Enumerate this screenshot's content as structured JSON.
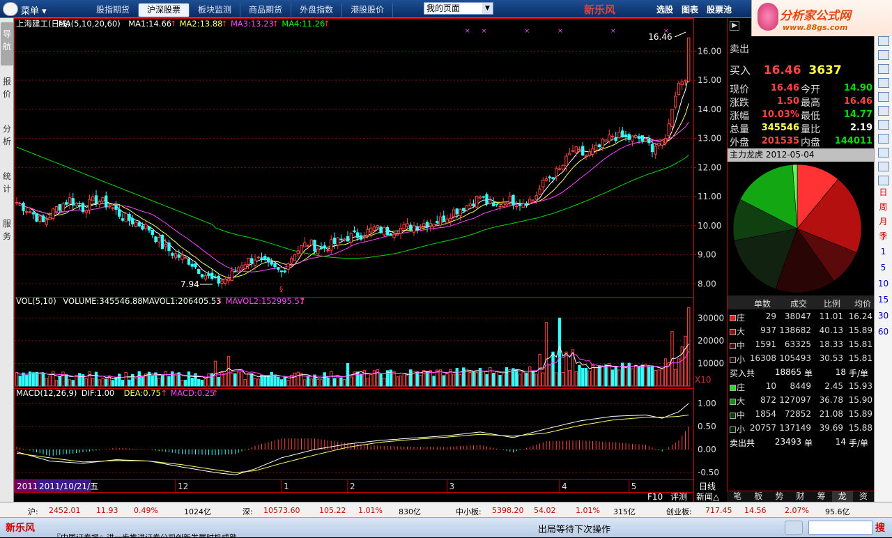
{
  "app": {
    "menu_label": "菜单",
    "brand": "新乐风",
    "status_brand": "新乐风"
  },
  "top_tabs": [
    "股指期货",
    "沪深股票",
    "板块监测",
    "商品期货",
    "外盘指数",
    "港股股价"
  ],
  "active_tab": 1,
  "page_select": "我的页面",
  "right_menu": [
    "选股",
    "图表",
    "股票池"
  ],
  "ad": {
    "line1": "分析家公式网",
    "line2": "www.88gs.com"
  },
  "left_nav": [
    "导航",
    "报价",
    "分析",
    "统计",
    "服务"
  ],
  "main_chart": {
    "legend": [
      {
        "text": "上海建工(日线)",
        "color": "#ffffff"
      },
      {
        "text": "MA(5,10,20,60)",
        "color": "#ffffff"
      },
      {
        "text": "MA1:14.66",
        "color": "#ffffff"
      },
      {
        "text": "MA2:13.88",
        "color": "#ffff66"
      },
      {
        "text": "MA3:13.23",
        "color": "#ff44ff"
      },
      {
        "text": "MA4:11.26",
        "color": "#00ff00"
      }
    ],
    "high_label": "16.46",
    "low_label": "7.94",
    "y_ticks": [
      "16.00",
      "15.00",
      "14.00",
      "13.00",
      "12.00",
      "11.00",
      "10.00",
      "9.00",
      "8.00"
    ]
  },
  "volume_chart": {
    "legend": [
      {
        "text": "VOL(5,10)",
        "color": "#ffffff"
      },
      {
        "text": "VOLUME:345546.88",
        "color": "#ffffff"
      },
      {
        "text": "MAVOL1:206405.53",
        "color": "#ffffff"
      },
      {
        "text": "MAVOL2:152995.57",
        "color": "#ff44ff"
      }
    ],
    "y_ticks": [
      "30000",
      "20000",
      "10000"
    ],
    "multiplier": "X10"
  },
  "macd_chart": {
    "legend": [
      {
        "text": "MACD(12,26,9)",
        "color": "#ffffff"
      },
      {
        "text": "DIF:1.00",
        "color": "#ffffff"
      },
      {
        "text": "DEA:0.75",
        "color": "#ffff66"
      },
      {
        "text": "MACD:0.25",
        "color": "#ff44ff"
      }
    ],
    "y_ticks": [
      "1.00",
      "0.50",
      "0.00",
      "-0.50"
    ]
  },
  "x_axis": {
    "year": "2011",
    "cursor_date": "2011/10/21/五",
    "months": [
      "12",
      "1",
      "2",
      "3",
      "4",
      "5"
    ],
    "period": "日线"
  },
  "bottom_labels": [
    "F10",
    "评测",
    "新闻△"
  ],
  "quote": {
    "sell_label": "卖出",
    "buy_label": "买入",
    "buy_price": "16.46",
    "buy_vol": "3637",
    "rows": [
      {
        "l1": "现价",
        "v1": "16.46",
        "c1": "red",
        "l2": "今开",
        "v2": "14.90",
        "c2": "grn"
      },
      {
        "l1": "涨跌",
        "v1": "1.50",
        "c1": "red",
        "l2": "最高",
        "v2": "16.46",
        "c2": "red"
      },
      {
        "l1": "涨幅",
        "v1": "10.03%",
        "c1": "red",
        "l2": "最低",
        "v2": "14.77",
        "c2": "grn"
      },
      {
        "l1": "总量",
        "v1": "345546",
        "c1": "yel",
        "l2": "量比",
        "v2": "2.19",
        "c2": "wht"
      },
      {
        "l1": "外盘",
        "v1": "201535",
        "c1": "red",
        "l2": "内盘",
        "v2": "144011",
        "c2": "grn"
      }
    ],
    "main_force_title": "主力龙虎 2012-05-04"
  },
  "pie": {
    "slices": [
      {
        "value": 11.01,
        "color": "#ff3333"
      },
      {
        "value": 20.1,
        "color": "#b51010"
      },
      {
        "value": 9.16,
        "color": "#5a0a0a"
      },
      {
        "value": 15.25,
        "color": "#2a0505"
      },
      {
        "value": 16.5,
        "color": "#112211"
      },
      {
        "value": 10.5,
        "color": "#104010"
      },
      {
        "value": 16.3,
        "color": "#13a813"
      },
      {
        "value": 1.18,
        "color": "#5cff5c"
      }
    ]
  },
  "flow_table": {
    "headers": [
      "单数",
      "成交",
      "比例",
      "均价"
    ],
    "buy_rows": [
      {
        "name": "庄",
        "count": "29",
        "amt": "38047",
        "pct": "11.01",
        "avg": "16.24",
        "sq": "#e02020"
      },
      {
        "name": "大",
        "count": "937",
        "amt": "138682",
        "pct": "40.13",
        "avg": "15.89",
        "sq": "#901010"
      },
      {
        "name": "中",
        "count": "1591",
        "amt": "63325",
        "pct": "18.33",
        "avg": "15.81",
        "sq": "#400808"
      },
      {
        "name": "小",
        "count": "16308",
        "amt": "105493",
        "pct": "30.53",
        "avg": "15.81",
        "sq": "#200404"
      }
    ],
    "buy_total": {
      "label": "买入共",
      "count": "18865",
      "unit": "单",
      "per": "18",
      "per_unit": "手/单"
    },
    "sell_rows": [
      {
        "name": "庄",
        "count": "10",
        "amt": "8449",
        "pct": "2.45",
        "avg": "15.93",
        "sq": "#20e020"
      },
      {
        "name": "大",
        "count": "872",
        "amt": "127097",
        "pct": "36.78",
        "avg": "15.90",
        "sq": "#109010"
      },
      {
        "name": "中",
        "count": "1854",
        "amt": "72852",
        "pct": "21.08",
        "avg": "15.89",
        "sq": "#084008"
      },
      {
        "name": "小",
        "count": "20757",
        "amt": "137149",
        "pct": "39.69",
        "avg": "15.88",
        "sq": "#042004"
      }
    ],
    "sell_total": {
      "label": "卖出共",
      "count": "23493",
      "unit": "单",
      "per": "14",
      "per_unit": "手/单"
    }
  },
  "right_tabs": [
    "笔",
    "板",
    "势",
    "财",
    "筹",
    "龙",
    "资"
  ],
  "right_tab_active": 5,
  "right_strip": {
    "periods": [
      "日",
      "周",
      "月",
      "季"
    ],
    "nums": [
      "1",
      "5",
      "10",
      "15",
      "30",
      "60"
    ]
  },
  "index_bar": {
    "sh": {
      "label": "沪:",
      "v": "2452.01",
      "chg": "11.93",
      "pct": "0.49%",
      "amt": "1024亿"
    },
    "sz": {
      "label": "深:",
      "v": "10573.60",
      "chg": "105.22",
      "pct": "1.01%",
      "amt": "830亿"
    },
    "zxb": {
      "label": "中小板:",
      "v": "5398.20",
      "chg": "54.02",
      "pct": "1.01%",
      "amt": "315亿"
    },
    "cyb": {
      "label": "创业板:",
      "v": "717.45",
      "chg": "14.56",
      "pct": "2.07%",
      "amt": "95.6亿"
    }
  },
  "status": {
    "message": "出局等待下次操作",
    "news": "『中国证券报』进一步推进证券公司创新发展时机成熟",
    "search_btn": "搜"
  },
  "chart_data": {
    "type": "candlestick",
    "price_axis": {
      "ylim": [
        7.6,
        16.8
      ]
    },
    "volume_axis": {
      "ylim": [
        0,
        35000
      ]
    },
    "macd_axis": {
      "ylim": [
        -0.65,
        1.12
      ]
    },
    "trend_points": [
      [
        0,
        10.8
      ],
      [
        4,
        10.5
      ],
      [
        8,
        10.1
      ],
      [
        12,
        10.6
      ],
      [
        16,
        10.9
      ],
      [
        20,
        10.6
      ],
      [
        24,
        10.9
      ],
      [
        28,
        10.7
      ],
      [
        32,
        10.3
      ],
      [
        36,
        10.1
      ],
      [
        40,
        9.9
      ],
      [
        44,
        9.3
      ],
      [
        48,
        9.0
      ],
      [
        52,
        8.8
      ],
      [
        56,
        8.4
      ],
      [
        60,
        8.05
      ],
      [
        64,
        8.2
      ],
      [
        68,
        8.7
      ],
      [
        72,
        8.9
      ],
      [
        76,
        8.6
      ],
      [
        80,
        8.4
      ],
      [
        84,
        9.1
      ],
      [
        88,
        9.4
      ],
      [
        92,
        9.2
      ],
      [
        96,
        9.4
      ],
      [
        100,
        9.6
      ],
      [
        104,
        9.7
      ],
      [
        108,
        9.9
      ],
      [
        112,
        9.8
      ],
      [
        116,
        9.9
      ],
      [
        120,
        10.0
      ],
      [
        124,
        10.1
      ],
      [
        128,
        10.2
      ],
      [
        132,
        10.5
      ],
      [
        136,
        10.7
      ],
      [
        140,
        11.0
      ],
      [
        144,
        10.6
      ],
      [
        148,
        10.9
      ],
      [
        152,
        10.8
      ],
      [
        156,
        10.9
      ],
      [
        160,
        11.6
      ],
      [
        164,
        11.9
      ],
      [
        168,
        12.6
      ],
      [
        172,
        12.4
      ],
      [
        176,
        12.7
      ],
      [
        180,
        13.1
      ],
      [
        184,
        13.0
      ],
      [
        188,
        13.0
      ],
      [
        192,
        12.7
      ],
      [
        196,
        13.0
      ],
      [
        198,
        14.0
      ],
      [
        200,
        14.9
      ],
      [
        202,
        15.0
      ],
      [
        203,
        16.46
      ]
    ],
    "volume_spikes": [
      [
        60,
        11000
      ],
      [
        64,
        13000
      ],
      [
        100,
        10000
      ],
      [
        160,
        28000
      ],
      [
        164,
        30000
      ],
      [
        168,
        16000
      ],
      [
        198,
        24000
      ],
      [
        202,
        22000
      ],
      [
        203,
        34554
      ]
    ],
    "dif_points": [
      [
        0,
        -0.05
      ],
      [
        10,
        -0.25
      ],
      [
        20,
        -0.3
      ],
      [
        30,
        -0.22
      ],
      [
        40,
        -0.25
      ],
      [
        50,
        -0.38
      ],
      [
        60,
        -0.5
      ],
      [
        66,
        -0.55
      ],
      [
        72,
        -0.42
      ],
      [
        80,
        -0.18
      ],
      [
        90,
        0.0
      ],
      [
        100,
        0.12
      ],
      [
        110,
        0.2
      ],
      [
        120,
        0.25
      ],
      [
        130,
        0.3
      ],
      [
        140,
        0.38
      ],
      [
        150,
        0.26
      ],
      [
        160,
        0.45
      ],
      [
        170,
        0.62
      ],
      [
        180,
        0.72
      ],
      [
        190,
        0.75
      ],
      [
        195,
        0.68
      ],
      [
        200,
        0.82
      ],
      [
        203,
        1.0
      ]
    ],
    "dea_points": [
      [
        0,
        -0.08
      ],
      [
        10,
        -0.18
      ],
      [
        20,
        -0.27
      ],
      [
        30,
        -0.24
      ],
      [
        40,
        -0.25
      ],
      [
        50,
        -0.33
      ],
      [
        60,
        -0.44
      ],
      [
        66,
        -0.5
      ],
      [
        72,
        -0.46
      ],
      [
        80,
        -0.3
      ],
      [
        90,
        -0.12
      ],
      [
        100,
        0.05
      ],
      [
        110,
        0.16
      ],
      [
        120,
        0.22
      ],
      [
        130,
        0.27
      ],
      [
        140,
        0.33
      ],
      [
        150,
        0.29
      ],
      [
        160,
        0.36
      ],
      [
        170,
        0.52
      ],
      [
        180,
        0.64
      ],
      [
        190,
        0.7
      ],
      [
        195,
        0.7
      ],
      [
        200,
        0.72
      ],
      [
        203,
        0.75
      ]
    ]
  }
}
